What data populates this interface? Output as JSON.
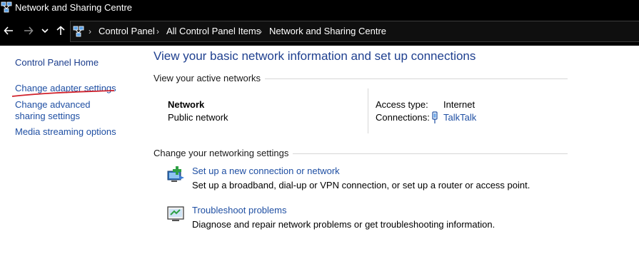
{
  "window": {
    "title": "Network and Sharing Centre",
    "icon": "network-centre-icon"
  },
  "nav": {
    "back_icon": "arrow-left-icon",
    "forward_icon": "arrow-right-icon",
    "recent_icon": "chevron-down-icon",
    "up_icon": "arrow-up-icon",
    "breadcrumbs": [
      "Control Panel",
      "All Control Panel Items",
      "Network and Sharing Centre"
    ]
  },
  "sidebar": {
    "items": [
      {
        "label": "Control Panel Home"
      },
      {
        "label": "Change adapter settings"
      },
      {
        "label": "Change advanced sharing settings"
      },
      {
        "label": "Media streaming options"
      }
    ]
  },
  "main": {
    "title": "View your basic network information and set up connections",
    "active_networks_header": "View your active networks",
    "network": {
      "name": "Network",
      "category": "Public network",
      "access_type_label": "Access type:",
      "access_type_value": "Internet",
      "connections_label": "Connections:",
      "connection_name": "TalkTalk",
      "connection_icon": "wifi-signal-icon"
    },
    "change_settings_header": "Change your networking settings",
    "tasks": [
      {
        "icon": "new-connection-icon",
        "link": "Set up a new connection or network",
        "description": "Set up a broadband, dial-up or VPN connection, or set up a router or access point."
      },
      {
        "icon": "troubleshoot-icon",
        "link": "Troubleshoot problems",
        "description": "Diagnose and repair network problems or get troubleshooting information."
      }
    ]
  },
  "colors": {
    "link": "#1f4fa3",
    "title": "#1e3f8f",
    "annotation": "#d0202a",
    "chrome": "#000000"
  }
}
